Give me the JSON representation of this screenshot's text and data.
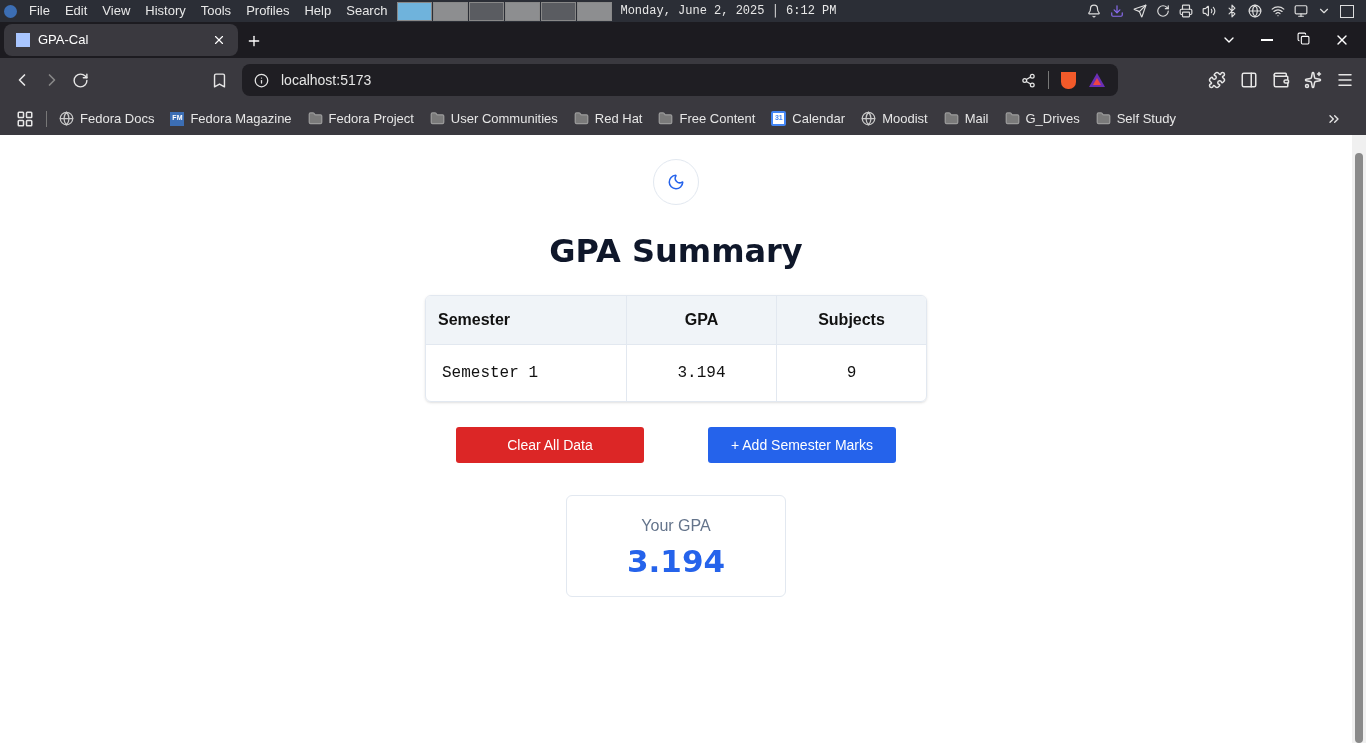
{
  "os_bar": {
    "menu": [
      "File",
      "Edit",
      "View",
      "History",
      "Tools",
      "Profiles",
      "Help",
      "Search"
    ],
    "workspaces": [
      {
        "selected": true
      },
      {
        "selected": false
      },
      {
        "selected": false
      },
      {
        "selected": false
      },
      {
        "selected": false
      },
      {
        "selected": false
      }
    ],
    "clock": "Monday, June 2, 2025 │ 6:12 PM"
  },
  "tabs": [
    {
      "title": "GPA-Cal",
      "selected": true
    }
  ],
  "address": "localhost:5173",
  "bookmarks": [
    {
      "label": "Fedora Docs",
      "kind": "globe"
    },
    {
      "label": "Fedora Magazine",
      "kind": "badge",
      "badge": "FM"
    },
    {
      "label": "Fedora Project",
      "kind": "folder"
    },
    {
      "label": "User Communities",
      "kind": "folder"
    },
    {
      "label": "Red Hat",
      "kind": "folder"
    },
    {
      "label": "Free Content",
      "kind": "folder"
    },
    {
      "label": "Calendar",
      "kind": "calendar",
      "badge": "31"
    },
    {
      "label": "Moodist",
      "kind": "globe"
    },
    {
      "label": "Mail",
      "kind": "folder"
    },
    {
      "label": "G_Drives",
      "kind": "folder"
    },
    {
      "label": "Self Study",
      "kind": "folder"
    }
  ],
  "page": {
    "title": "GPA Summary",
    "table": {
      "columns": [
        "Semester",
        "GPA",
        "Subjects"
      ],
      "rows": [
        [
          "Semester 1",
          "3.194",
          "9"
        ]
      ]
    },
    "buttons": [
      {
        "label": "Clear All Data",
        "kind": "danger"
      },
      {
        "label": "+ Add Semester Marks",
        "kind": "primary"
      }
    ],
    "result": {
      "label": "Your GPA",
      "value": "3.194"
    }
  }
}
